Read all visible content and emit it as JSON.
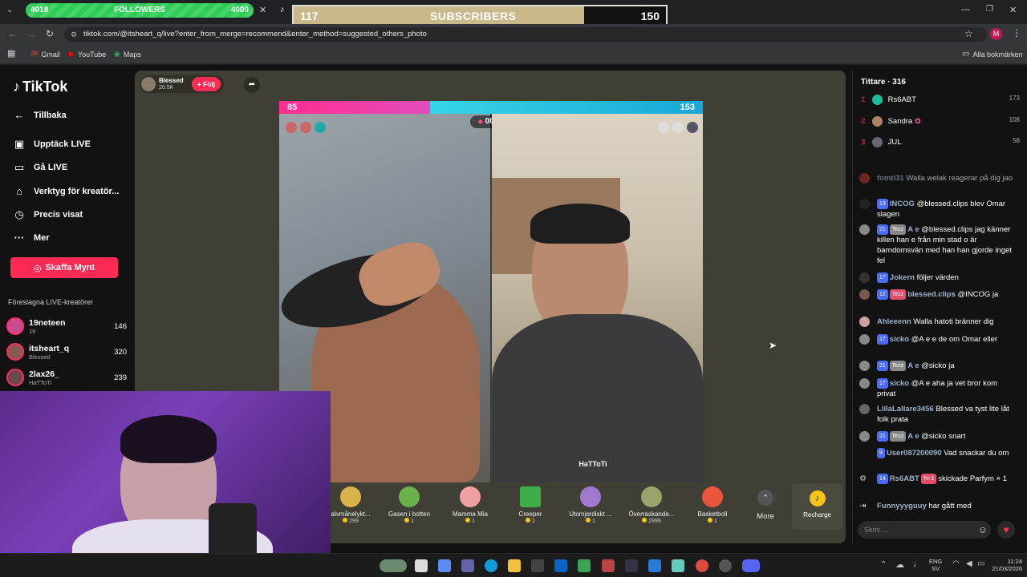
{
  "overlays": {
    "followers": {
      "current": "4018",
      "label": "FOLLOWERS",
      "goal": "4000",
      "progress": 1.0
    },
    "subscribers": {
      "current": "117",
      "label": "SUBSCRIBERS",
      "goal": "150",
      "progress": 0.78
    }
  },
  "browser": {
    "url": "tiktok.com/@itsheart_q/live?enter_from_merge=recommend&enter_method=suggested_others_photo",
    "bookmarks": [
      "Gmail",
      "YouTube",
      "Maps"
    ],
    "all_bookmarks": "Alla bokmärken",
    "profile_initial": "M"
  },
  "sidebar": {
    "logo": "TikTok",
    "back": "Tillbaka",
    "items": [
      {
        "label": "Upptäck LIVE",
        "icon": "calendar-icon"
      },
      {
        "label": "Gå LIVE",
        "icon": "video-icon"
      },
      {
        "label": "Verktyg för kreatör...",
        "icon": "home-tool-icon"
      },
      {
        "label": "Precis visat",
        "icon": "history-icon"
      },
      {
        "label": "Mer",
        "icon": "more-icon"
      }
    ],
    "coins_button": "Skaffa Mynt",
    "suggested_title": "Föreslagna LIVE-kreatörer",
    "suggested": [
      {
        "name": "19neteen",
        "sub": "19",
        "count": "146"
      },
      {
        "name": "itsheart_q",
        "sub": "Blessed",
        "count": "320"
      },
      {
        "name": "2lax26_",
        "sub": "HaTToTi",
        "count": "239"
      }
    ]
  },
  "host": {
    "name": "Blessed",
    "likes": "20.5K",
    "follow_label": "+ Följ"
  },
  "battle": {
    "left_score": "85",
    "right_score": "153",
    "left_fraction": 0.357,
    "timer": "00:29",
    "right_name": "HaTToTi"
  },
  "gifts": [
    {
      "name": "alvmånelykt...",
      "price": "299",
      "color": "#d9b24a"
    },
    {
      "name": "Gasen i botten",
      "price": "1",
      "color": "#6ab04c"
    },
    {
      "name": "Mamma Mia",
      "price": "1",
      "color": "#f0a0a0"
    },
    {
      "name": "Creeper",
      "price": "1",
      "color": "#3fae4a"
    },
    {
      "name": "Utomjordiskt ...",
      "price": "1",
      "color": "#a07ad0"
    },
    {
      "name": "Överraskande...",
      "price": "2999",
      "color": "#9aa36a"
    },
    {
      "name": "Basketboll",
      "price": "1",
      "color": "#e8553a"
    }
  ],
  "gift_more": "More",
  "recharge": "Recharge",
  "viewers": {
    "title": "Tittare · 316",
    "top": [
      {
        "rank": "1",
        "name": "Rs6ABT",
        "score": "173"
      },
      {
        "rank": "2",
        "name": "Sandra",
        "score": "108"
      },
      {
        "rank": "3",
        "name": "JUL",
        "score": "58"
      }
    ]
  },
  "chat": [
    {
      "level": "",
      "user": "fomti31",
      "text": "Walla welak reagerar på dig jao",
      "tag": ""
    },
    {
      "level": "13",
      "user": "INCOG",
      "text": "@blessed.clips blev Omar slagen",
      "tag": ""
    },
    {
      "level": "21",
      "user": "A e",
      "text": "@blessed.clips jag känner killen han e från min stad o är barndomsvän med han han gjorde inget fel",
      "tag": "Tezz"
    },
    {
      "level": "17",
      "user": "Jokern",
      "text": "följer värden",
      "tag": ""
    },
    {
      "level": "12",
      "user": "blessed.clips",
      "text": "@INCOG ja",
      "tag": "Tezz"
    },
    {
      "level": "",
      "user": "Ahleeenn",
      "text": "Walla hatoti bränner dig",
      "tag": ""
    },
    {
      "level": "17",
      "user": "sicko",
      "text": "@A e e de om Omar eller",
      "tag": ""
    },
    {
      "level": "21",
      "user": "A e",
      "text": "@sicko ja",
      "tag": "Tezz"
    },
    {
      "level": "17",
      "user": "sicko",
      "text": "@A e aha ja vet bror kom privat",
      "tag": ""
    },
    {
      "level": "",
      "user": "LillaLallare3456",
      "text": "Blessed va tyst lite låt folk prata",
      "tag": ""
    },
    {
      "level": "21",
      "user": "A e",
      "text": "@sicko snart",
      "tag": "Tezz"
    },
    {
      "level": "9",
      "user": "User087200090",
      "text": "Vad snackar du om",
      "tag": ""
    },
    {
      "level": "14",
      "user": "Rs6ABT",
      "text": "skickade Parfym × 1",
      "tag": "Nr.1"
    },
    {
      "level": "",
      "user": "Funnyyyguuy",
      "text": "har gått med",
      "tag": ""
    }
  ],
  "chat_placeholder": "Skriv ...",
  "taskbar": {
    "lang": "ENG",
    "lang_sub": "SV",
    "time": "11:24",
    "date": "21/03/2026"
  }
}
